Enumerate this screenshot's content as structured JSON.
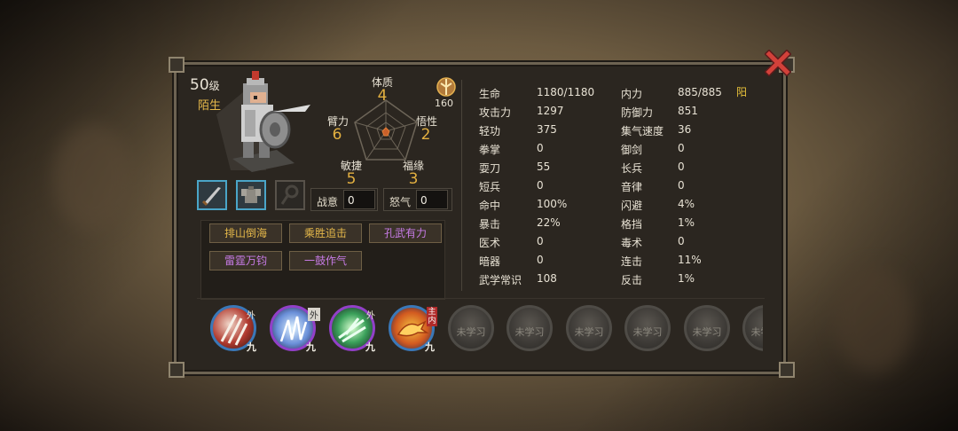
{
  "character": {
    "level": "50",
    "level_unit": "级",
    "name": "陌生",
    "power_value": "160"
  },
  "attributes": {
    "constitution": {
      "label": "体质",
      "value": "4"
    },
    "strength": {
      "label": "臂力",
      "value": "6"
    },
    "insight": {
      "label": "悟性",
      "value": "2"
    },
    "agility": {
      "label": "敏捷",
      "value": "5"
    },
    "fortune": {
      "label": "福缘",
      "value": "3"
    }
  },
  "gauges": {
    "fighting_spirit": {
      "label": "战意",
      "value": "0"
    },
    "rage": {
      "label": "怒气",
      "value": "0"
    }
  },
  "skill_tags": [
    {
      "label": "排山倒海",
      "color": "#e5b84a"
    },
    {
      "label": "乘胜追击",
      "color": "#e5b84a"
    },
    {
      "label": "孔武有力",
      "color": "#c77be6"
    },
    {
      "label": "雷霆万钧",
      "color": "#c77be6"
    },
    {
      "label": "一鼓作气",
      "color": "#c77be6"
    }
  ],
  "stats_left": [
    {
      "label": "生命",
      "value": "1180/1180"
    },
    {
      "label": "攻击力",
      "value": "1297"
    },
    {
      "label": "轻功",
      "value": "375"
    },
    {
      "label": "拳掌",
      "value": "0"
    },
    {
      "label": "耍刀",
      "value": "55"
    },
    {
      "label": "短兵",
      "value": "0"
    },
    {
      "label": "命中",
      "value": "100%"
    },
    {
      "label": "暴击",
      "value": "22%"
    },
    {
      "label": "医术",
      "value": "0"
    },
    {
      "label": "暗器",
      "value": "0"
    },
    {
      "label": "武学常识",
      "value": "108"
    }
  ],
  "stats_right": [
    {
      "label": "内力",
      "value": "885/885"
    },
    {
      "label": "防御力",
      "value": "851"
    },
    {
      "label": "集气速度",
      "value": "36"
    },
    {
      "label": "御剑",
      "value": "0"
    },
    {
      "label": "长兵",
      "value": "0"
    },
    {
      "label": "音律",
      "value": "0"
    },
    {
      "label": "闪避",
      "value": "4%"
    },
    {
      "label": "格挡",
      "value": "1%"
    },
    {
      "label": "毒术",
      "value": "0"
    },
    {
      "label": "连击",
      "value": "11%"
    },
    {
      "label": "反击",
      "value": "1%"
    }
  ],
  "alignment": "阳",
  "martial_skills": [
    {
      "tag": "外",
      "level": "九"
    },
    {
      "tag": "外",
      "level": "九"
    },
    {
      "tag": "外",
      "level": "九"
    },
    {
      "tag": "主内",
      "level": "九"
    }
  ],
  "locked_label": "未学习"
}
